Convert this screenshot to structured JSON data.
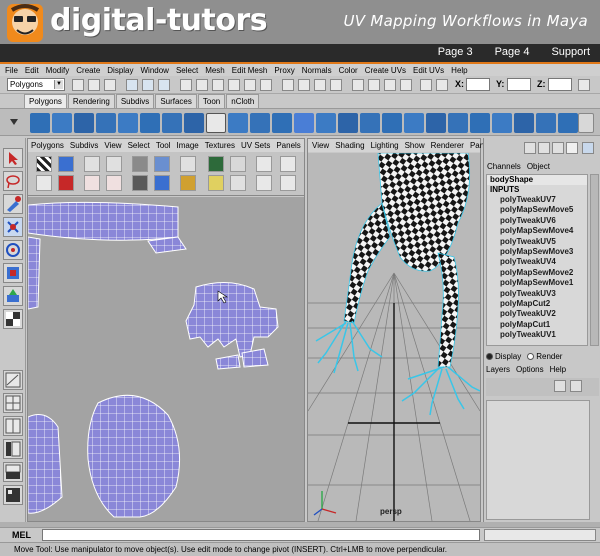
{
  "banner": {
    "logo": "digital-tutors",
    "title": "UV Mapping Workflows in Maya",
    "nav": [
      "Page 3",
      "Page 4",
      "Support"
    ]
  },
  "maya": {
    "menus": [
      "File",
      "Edit",
      "Modify",
      "Create",
      "Display",
      "Window",
      "Select",
      "Mesh",
      "Edit Mesh",
      "Proxy",
      "Normals",
      "Color",
      "Create UVs",
      "Edit UVs",
      "Help"
    ],
    "mode": "Polygons",
    "coords": {
      "x": "X:",
      "y": "Y:",
      "z": "Z:"
    },
    "shelf_tabs": [
      "Polygons",
      "Rendering",
      "Subdivs",
      "Surfaces",
      "Toon",
      "nCloth"
    ],
    "active_shelf": "Polygons"
  },
  "uv_editor": {
    "menus": [
      "Polygons",
      "Subdivs",
      "View",
      "Select",
      "Tool",
      "Image",
      "Textures",
      "UV Sets",
      "Panels"
    ]
  },
  "viewport": {
    "menus": [
      "View",
      "Shading",
      "Lighting",
      "Show",
      "Renderer",
      "Panels"
    ],
    "camera": "persp"
  },
  "channel_box": {
    "tabs": [
      "Channels",
      "Object"
    ],
    "node": "bodyShape",
    "inputs_label": "INPUTS",
    "inputs": [
      "polyTweakUV7",
      "polyMapSewMove5",
      "polyTweakUV6",
      "polyMapSewMove4",
      "polyTweakUV5",
      "polyMapSewMove3",
      "polyTweakUV4",
      "polyMapSewMove2",
      "polyMapSewMove1",
      "polyTweakUV3",
      "polyMapCut2",
      "polyTweakUV2",
      "polyMapCut1",
      "polyTweakUV1"
    ],
    "layer_modes": [
      "Display",
      "Render"
    ],
    "layer_menus": [
      "Layers",
      "Options",
      "Help"
    ]
  },
  "command_line": {
    "label": "MEL",
    "help": "Move Tool: Use manipulator to move object(s). Use edit mode to change pivot (INSERT). Ctrl+LMB to move perpendicular."
  }
}
